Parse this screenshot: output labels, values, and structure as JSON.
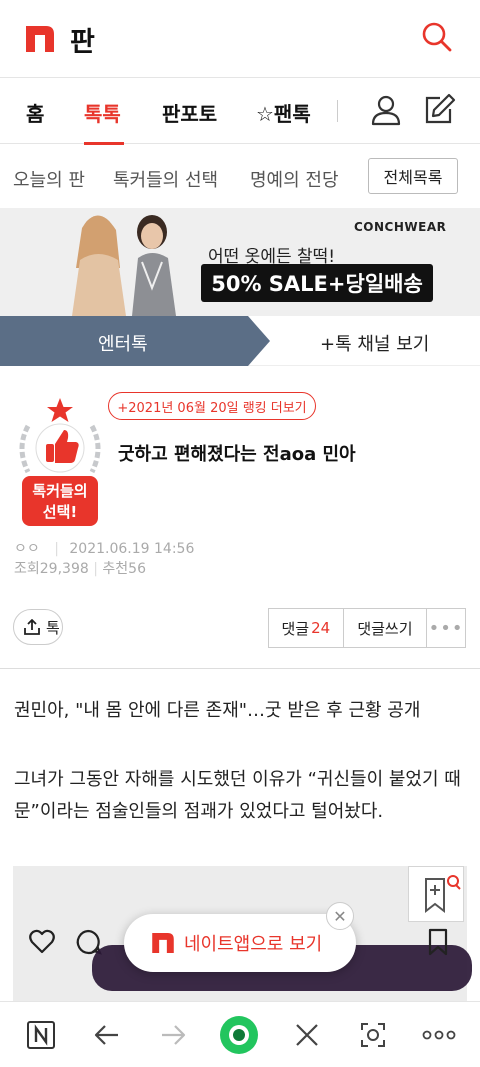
{
  "header": {
    "site_title": "판"
  },
  "nav": {
    "tabs": [
      {
        "label": "홈"
      },
      {
        "label": "톡톡"
      },
      {
        "label": "판포토"
      },
      {
        "label": "☆팬톡"
      }
    ]
  },
  "subnav": {
    "tabs": [
      {
        "label": "오늘의 판"
      },
      {
        "label": "톡커들의 선택"
      },
      {
        "label": "명예의 전당"
      }
    ],
    "all_list": "전체목록"
  },
  "ad": {
    "brand": "CONCHWEAR",
    "copy": "어떤 옷에든 찰떡!",
    "sale": "50% SALE+당일배송"
  },
  "channel": {
    "current": "엔터톡",
    "more": "+톡 채널 보기"
  },
  "post": {
    "rank_link": "+2021년 06월 20일 랭킹 더보기",
    "badge_text_1": "톡커들의",
    "badge_text_2": "선택!",
    "title": "굿하고 편해졌다는 전aoa 민아",
    "author": "ㅇㅇ",
    "date": "2021.06.19 14:56",
    "views_label": "조회",
    "views": "29,398",
    "recommend_label": "추천",
    "recommend": "56",
    "share_label": "톡",
    "comments_label": "댓글",
    "comments_count": "24",
    "write_comment": "댓글쓰기",
    "body_line1": "권민아, \"내 몸 안에 다른 존재\"…굿 받은 후 근황 공개",
    "body_line2": "그녀가 그동안 자해를 시도했던 이유가 “귀신들이 붙었기 때문”이라는 점술인들의 점괘가 있었다고 털어놨다."
  },
  "popup": {
    "label": "네이트앱으로 보기"
  },
  "colors": {
    "accent": "#e8352b",
    "channel_bg": "#5b6e86"
  }
}
